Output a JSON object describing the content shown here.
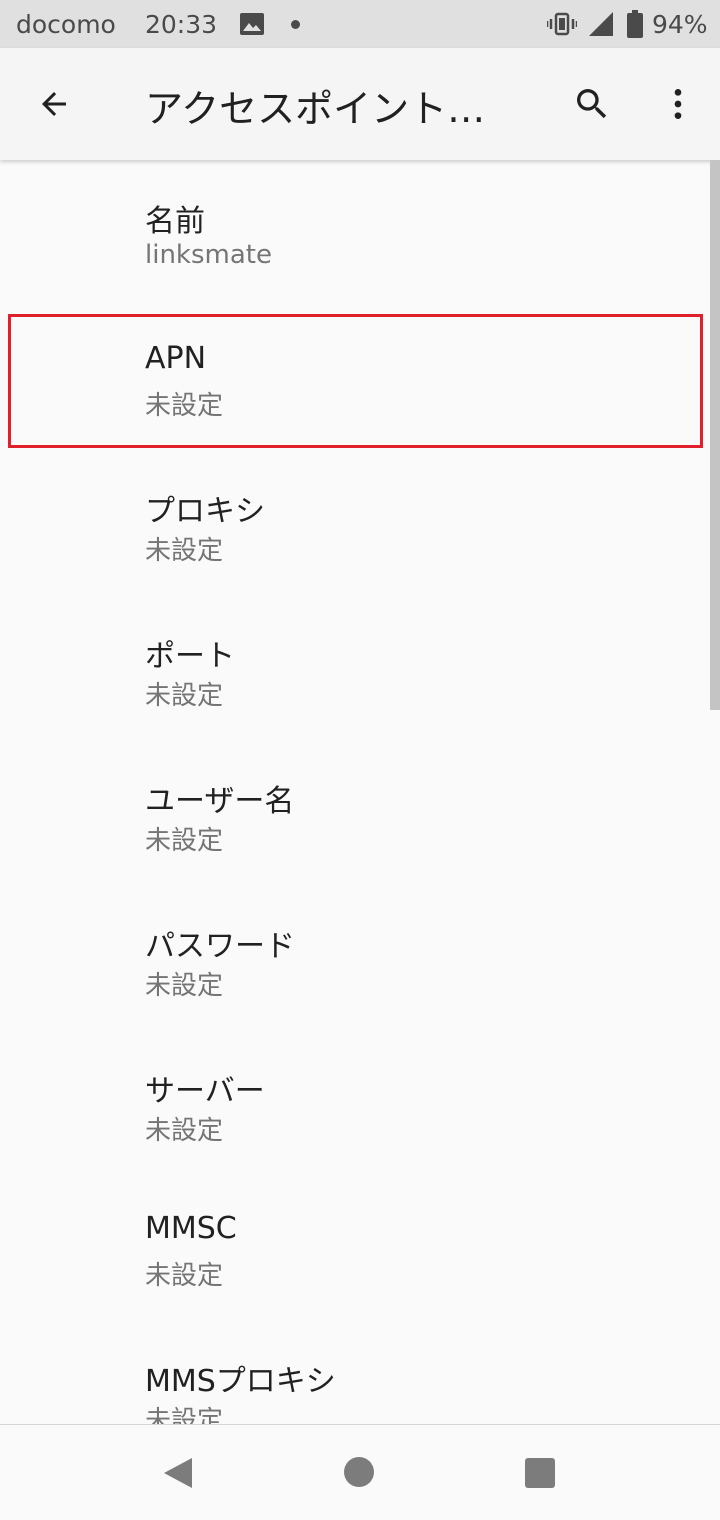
{
  "status_bar": {
    "carrier": "docomo",
    "time": "20:33",
    "battery": "94%",
    "icons": [
      "gallery-icon",
      "notification-dot-icon",
      "vibrate-icon",
      "signal-icon",
      "battery-icon"
    ]
  },
  "app_bar": {
    "title": "アクセスポイント…",
    "icons": [
      "back-arrow-icon",
      "search-icon",
      "more-vert-icon"
    ]
  },
  "list": {
    "items": [
      {
        "title": "名前",
        "summary": "linksmate"
      },
      {
        "title": "APN",
        "summary": "未設定"
      },
      {
        "title": "プロキシ",
        "summary": "未設定"
      },
      {
        "title": "ポート",
        "summary": "未設定"
      },
      {
        "title": "ユーザー名",
        "summary": "未設定"
      },
      {
        "title": "パスワード",
        "summary": "未設定"
      },
      {
        "title": "サーバー",
        "summary": "未設定"
      },
      {
        "title": "MMSC",
        "summary": "未設定"
      },
      {
        "title": "MMSプロキシ",
        "summary": "未設定"
      }
    ],
    "highlighted_item": "APN",
    "highlight_color": "#e0202a"
  },
  "nav_bar": {
    "icons": [
      "nav-back-icon",
      "nav-home-icon",
      "nav-recents-icon"
    ]
  }
}
